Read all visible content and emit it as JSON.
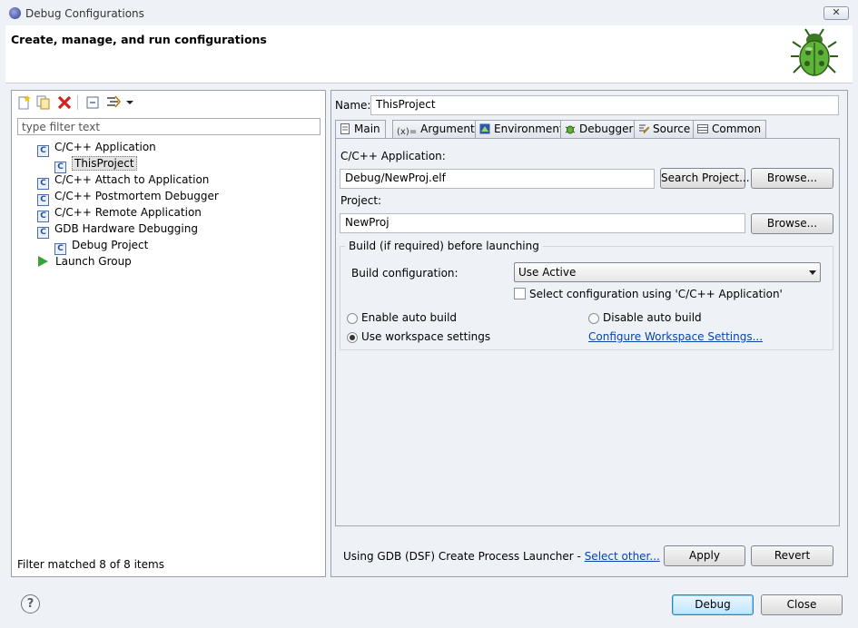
{
  "window": {
    "title": "Debug Configurations",
    "close_label": "✕",
    "heading": "Create, manage, and run configurations"
  },
  "left": {
    "toolbar": {
      "new_label": "New launch configuration",
      "duplicate_label": "Duplicate",
      "delete_label": "Delete",
      "collapse_label": "Collapse All",
      "filter_label": "Filter"
    },
    "filter_placeholder": "type filter text",
    "tree": [
      {
        "label": "C/C++ Application",
        "icon": "c-config-icon"
      },
      {
        "label": "ThisProject",
        "icon": "c-config-icon",
        "selected": true
      },
      {
        "label": "C/C++ Attach to Application",
        "icon": "c-config-icon"
      },
      {
        "label": "C/C++ Postmortem Debugger",
        "icon": "c-config-icon"
      },
      {
        "label": "C/C++ Remote Application",
        "icon": "c-config-icon"
      },
      {
        "label": "GDB Hardware Debugging",
        "icon": "c-config-icon"
      },
      {
        "label": "Debug Project",
        "icon": "c-config-icon"
      },
      {
        "label": "Launch Group",
        "icon": "launch-group-icon"
      }
    ],
    "status": "Filter matched 8 of 8 items"
  },
  "right": {
    "name_label": "Name:",
    "name_value": "ThisProject",
    "tabs": [
      {
        "label": "Main",
        "icon": "main-icon"
      },
      {
        "label": "Arguments",
        "icon": "arguments-icon"
      },
      {
        "label": "Environment",
        "icon": "environment-icon"
      },
      {
        "label": "Debugger",
        "icon": "debugger-icon"
      },
      {
        "label": "Source",
        "icon": "source-icon"
      },
      {
        "label": "Common",
        "icon": "common-icon"
      }
    ],
    "main": {
      "app_label": "C/C++ Application:",
      "app_value": "Debug/NewProj.elf",
      "search_project": "Search Project...",
      "browse": "Browse...",
      "project_label": "Project:",
      "project_value": "NewProj",
      "browse2": "Browse...",
      "build_group_title": "Build (if required) before launching",
      "build_config_label": "Build configuration:",
      "build_config_value": "Use Active",
      "select_config_label": "Select configuration using 'C/C++ Application'",
      "enable_auto_build": "Enable auto build",
      "disable_auto_build": "Disable auto build",
      "use_workspace": "Use workspace settings",
      "configure_workspace": "Configure Workspace Settings..."
    },
    "launcher_text": "Using GDB (DSF) Create Process Launcher - ",
    "select_other": "Select other...",
    "apply": "Apply",
    "revert": "Revert"
  },
  "footer": {
    "help": "?",
    "debug": "Debug",
    "close": "Close"
  },
  "colors": {
    "link": "#0645ad",
    "window_bg": "#eef1f6",
    "selection": "#e3e3e3"
  }
}
